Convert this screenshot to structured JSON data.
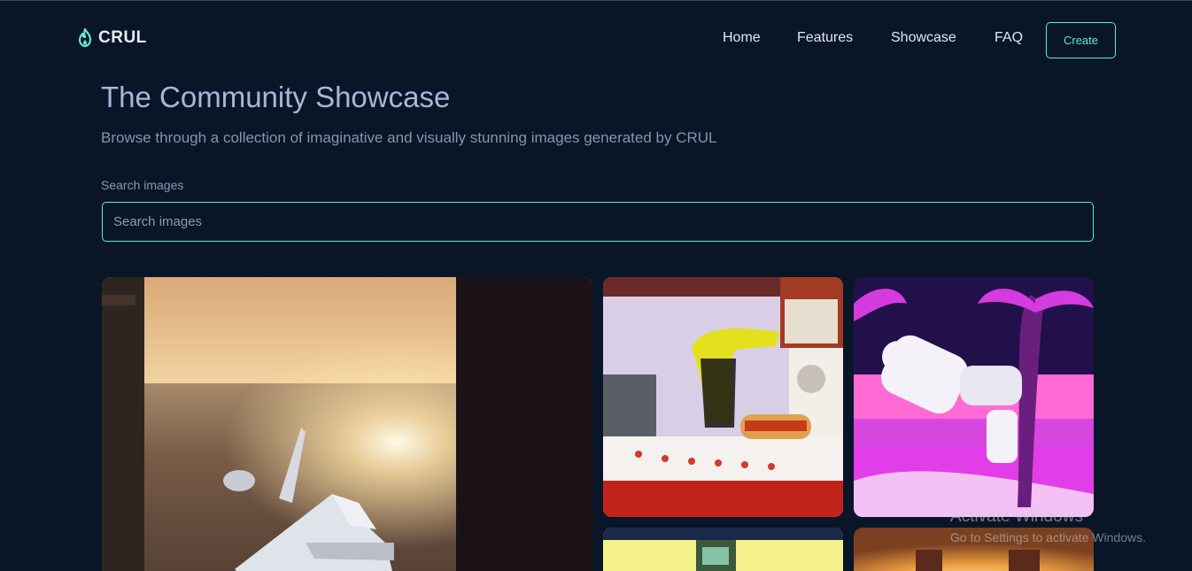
{
  "brand": {
    "name": "CRUL",
    "icon": "flame-icon",
    "accent": "#5eead4"
  },
  "nav": {
    "links": [
      "Home",
      "Features",
      "Showcase",
      "FAQ"
    ],
    "create_label": "Create"
  },
  "header": {
    "title": "The Community Showcase",
    "subtitle": "Browse through a collection of imaginative and visually stunning images generated by CRUL"
  },
  "search": {
    "label": "Search images",
    "placeholder": "Search images",
    "value": ""
  },
  "showcase": {
    "images": [
      {
        "name": "space-shuttle-over-city"
      },
      {
        "name": "dinosaur-hotdog-stand"
      },
      {
        "name": "astronaut-synthwave-beach"
      },
      {
        "name": "yellow-room-machine"
      },
      {
        "name": "sunset-scene"
      }
    ]
  },
  "watermark": {
    "title": "Activate Windows",
    "subtitle": "Go to Settings to activate Windows."
  }
}
